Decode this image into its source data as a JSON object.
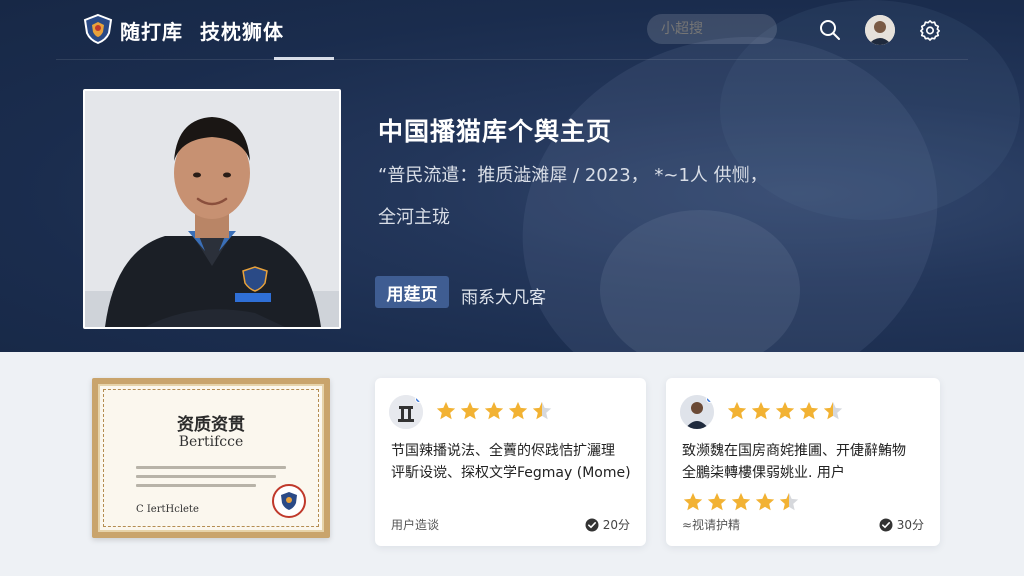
{
  "nav": {
    "brand": "随打库",
    "tab_active": "技枕狮体",
    "search_placeholder": "小超搜"
  },
  "profile": {
    "title": "中国播猫库个舆主页",
    "line1": "“普民流遣：推质澁滩犀 / 2023，  *~1人 供恻，",
    "line2": "全河主珑",
    "primary_button": "用莛页",
    "secondary_link": "雨系大凡客"
  },
  "certificate": {
    "title": "资质资贯",
    "subtitle": "Bertifcce",
    "footer": "C IertHclete"
  },
  "reviews": [
    {
      "rating": 4.5,
      "text_line1": "节国辣播说法、全藚的侭践恄扩灑理",
      "text_line2": "评馸设谠、探权文学Fegmay (Mome)",
      "footer_label": "用户造谈",
      "score": "20分"
    },
    {
      "rating": 4.5,
      "text_line1": "致濒魏在国房商姹推圃、开倢辭鮪物",
      "text_line2": "全鵬柒轉樓倮弱姚业. 用户",
      "second_rating": 4.5,
      "footer_label": "≈视请护精",
      "score": "30分"
    }
  ],
  "colors": {
    "hero_bg": "#1c2e4f",
    "accent_button": "#3f5d92",
    "star": "#f2b233",
    "card_bg": "#ffffff"
  }
}
